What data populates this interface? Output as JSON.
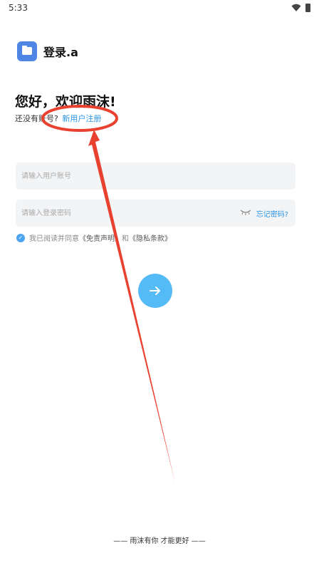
{
  "status": {
    "time": "5:33"
  },
  "header": {
    "app_name": "登录.a",
    "logo_icon": "folder-icon"
  },
  "greeting": {
    "title": "您好，欢迎雨沫!",
    "no_account": "还没有账号?",
    "signup_link": "新用户注册"
  },
  "form": {
    "account_placeholder": "请输入用户账号",
    "password_placeholder": "请输入登录密码",
    "forgot_link": "忘记密码?"
  },
  "agreement": {
    "text": "我已阅读并同意",
    "disclaimer": "《免责声明》",
    "and": "和",
    "privacy": "《隐私条款》"
  },
  "footer": {
    "slogan": "—— 雨沫有你 才能更好 ——"
  },
  "colors": {
    "accent": "#2c95e5",
    "button": "#55bbf7",
    "annotation": "#e8412f"
  }
}
